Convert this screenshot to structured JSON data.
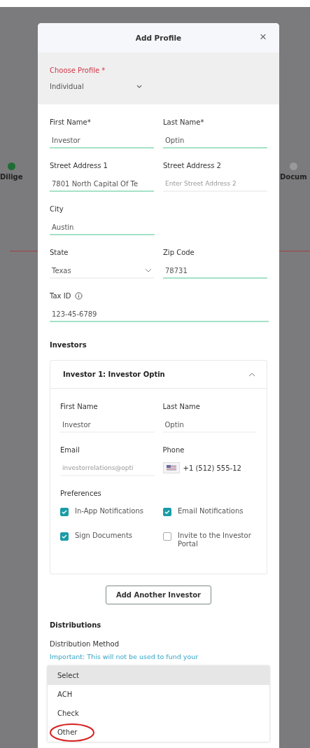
{
  "background": {
    "steps": [
      {
        "label": "Dilige",
        "done": true
      },
      {
        "label": "Docum",
        "done": false
      }
    ]
  },
  "modal": {
    "title": "Add Profile",
    "close": "×",
    "profile": {
      "label": "Choose Profile *",
      "value": "Individual"
    },
    "rows": [
      [
        {
          "label": "First Name*",
          "value": "Investor",
          "kind": "input",
          "focused": true
        },
        {
          "label": "Last Name*",
          "value": "Optin",
          "kind": "input",
          "focused": true
        }
      ],
      [
        {
          "label": "Street Address 1",
          "value": "7801 North Capital Of Te",
          "kind": "input",
          "focused": true
        },
        {
          "label": "Street Address 2",
          "placeholder": "Enter Street Address 2",
          "kind": "input",
          "focused": false
        }
      ],
      [
        {
          "label": "City",
          "value": "Austin",
          "kind": "input",
          "focused": true
        }
      ],
      [
        {
          "label": "State",
          "value": "Texas",
          "kind": "select",
          "focused": false
        },
        {
          "label": "Zip Code",
          "value": "78731",
          "kind": "input",
          "focused": true
        }
      ],
      [
        {
          "label": "Tax ID",
          "value": "123-45-6789",
          "kind": "input",
          "focused": true,
          "info": true
        }
      ]
    ],
    "investors_heading": "Investors",
    "investor": {
      "title": "Investor 1: Investor Optin",
      "expanded": true,
      "rows": [
        [
          {
            "label": "First Name",
            "value": "Investor",
            "kind": "input"
          },
          {
            "label": "Last Name",
            "value": "Optin",
            "kind": "input"
          }
        ],
        [
          {
            "label": "Email",
            "placeholder": "investorrelations@opti",
            "kind": "input"
          },
          {
            "label": "Phone",
            "value": "+1 (512) 555-12",
            "kind": "phone"
          }
        ]
      ],
      "preferences_label": "Preferences",
      "preferences": [
        {
          "label": "In-App Notifications",
          "checked": true
        },
        {
          "label": "Email Notifications",
          "checked": true
        },
        {
          "label": "Sign Documents",
          "checked": true
        },
        {
          "label": "Invite to the Investor Portal",
          "checked": false
        }
      ]
    },
    "add_button": "Add Another Investor",
    "distributions_heading": "Distributions",
    "method_label": "Distribution Method",
    "method_note": "Important: This will not be used to fund your",
    "options": [
      {
        "label": "Select",
        "selected": true,
        "circled": false
      },
      {
        "label": "ACH",
        "selected": false,
        "circled": false
      },
      {
        "label": "Check",
        "selected": false,
        "circled": false
      },
      {
        "label": "Other",
        "selected": false,
        "circled": true
      }
    ]
  }
}
